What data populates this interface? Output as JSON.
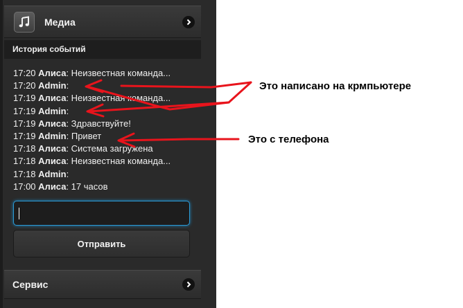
{
  "media": {
    "label": "Медиа",
    "icon": "music-note-icon"
  },
  "history": {
    "title": "История событий",
    "lines": [
      {
        "time": "17:20",
        "sender": "Алиса",
        "text": "Неизвестная команда..."
      },
      {
        "time": "17:20",
        "sender": "Admin",
        "text": ""
      },
      {
        "time": "17:19",
        "sender": "Алиса",
        "text": "Неизвестная команда..."
      },
      {
        "time": "17:19",
        "sender": "Admin",
        "text": ""
      },
      {
        "time": "17:19",
        "sender": "Алиса",
        "text": "Здравствуйте!"
      },
      {
        "time": "17:19",
        "sender": "Admin",
        "text": "Привет"
      },
      {
        "time": "17:18",
        "sender": "Алиса",
        "text": "Система загружена"
      },
      {
        "time": "17:18",
        "sender": "Алиса",
        "text": "Неизвестная команда..."
      },
      {
        "time": "17:18",
        "sender": "Admin",
        "text": ""
      },
      {
        "time": "17:00",
        "sender": "Алиса",
        "text": "17 часов"
      }
    ]
  },
  "input": {
    "value": ""
  },
  "send_button": {
    "label": "Отправить"
  },
  "service": {
    "label": "Сервис",
    "icon": "chevron-right-icon"
  },
  "annotations": {
    "computer": "Это написано на крмпьютере",
    "phone": "Это с телефона"
  },
  "colors": {
    "panel": "#2a2a2a",
    "input_focus": "#2c9bd6",
    "arrows": "#e8141c"
  }
}
